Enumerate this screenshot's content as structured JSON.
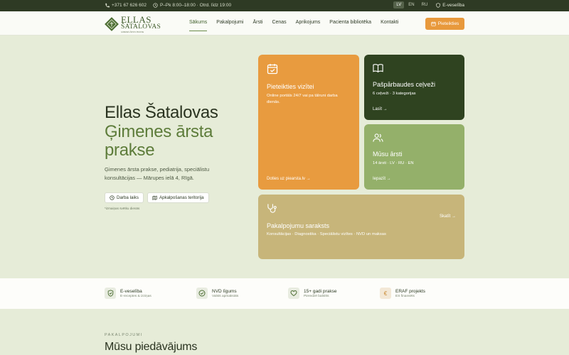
{
  "topbar": {
    "phone": "+371 67 626 602",
    "hours": "P–Pk 8:00–18:00 · Otrd. līdz 19:00",
    "languages": [
      "LV",
      "EN",
      "RU"
    ],
    "active_language": "LV",
    "eveseliba": "E-veselība"
  },
  "logo": {
    "line1": "ELLAS",
    "line2": "ŠATALOVAS",
    "tagline": "ĢIMENES ĀRSTA PRAKSE"
  },
  "nav": {
    "items": [
      "Sākums",
      "Pakalpojumi",
      "Ārsti",
      "Cenas",
      "Aprikojums",
      "Pacienta bibliotēka",
      "Kontakti"
    ],
    "active": "Sākums",
    "cta": "Pieteikties"
  },
  "hero": {
    "title_line1": "Ellas Šatalovas",
    "title_line2": "Ģimenes ārsta",
    "title_line3": "prakse",
    "description": "Ģimenes ārsta prakse, pediatrija, speciālistu konsultācijas — Mārupes ielā 4, Rīgā.",
    "btn_hours": "Darba laiks",
    "btn_territory": "Apkalpošanas teritorija",
    "note": "*izmaiņas svētku dienās"
  },
  "cards": {
    "appointment": {
      "title": "Pieteikties vizītei",
      "subtitle": "Online portāls 24/7 vai pa tālruni darba dienās.",
      "link": "Doties uz piearsta.lv →"
    },
    "selfcheck": {
      "title": "Pašpārbaudes ceļveži",
      "subtitle": "6 ceļveži · 3 kategorijas",
      "link": "Lasīt →"
    },
    "doctors": {
      "title": "Mūsu ārsti",
      "subtitle": "14 ārsti · LV · RU · EN",
      "link": "Iepazīt →"
    },
    "services": {
      "title": "Pakalpojumu saraksts",
      "subtitle": "Konsultācijas · Diagnostika · Speciālistu vizītes · NVD un maksas",
      "link": "Skatīt →"
    }
  },
  "stats": [
    {
      "title": "E-veselība",
      "sub": "E-receptes & izziņas",
      "icon": "shield-check-icon"
    },
    {
      "title": "NVD līgums",
      "sub": "Valsts apmaksāts",
      "icon": "check-circle-icon"
    },
    {
      "title": "15+ gadi prakse",
      "sub": "Pieredzē balstīts",
      "icon": "heart-hand-icon"
    },
    {
      "title": "ERAF projekts",
      "sub": "ES finansēts",
      "icon": "euro-icon"
    }
  ],
  "section": {
    "kicker": "PAKALPOJUMI",
    "title": "Mūsu piedāvājums"
  },
  "colors": {
    "topbar": "#2e3a24",
    "accent_orange": "#e89b3f",
    "dark_green": "#2f4320",
    "light_green": "#94b06a",
    "khaki": "#c7b57a",
    "hero_bg": "#e6ecd8"
  }
}
